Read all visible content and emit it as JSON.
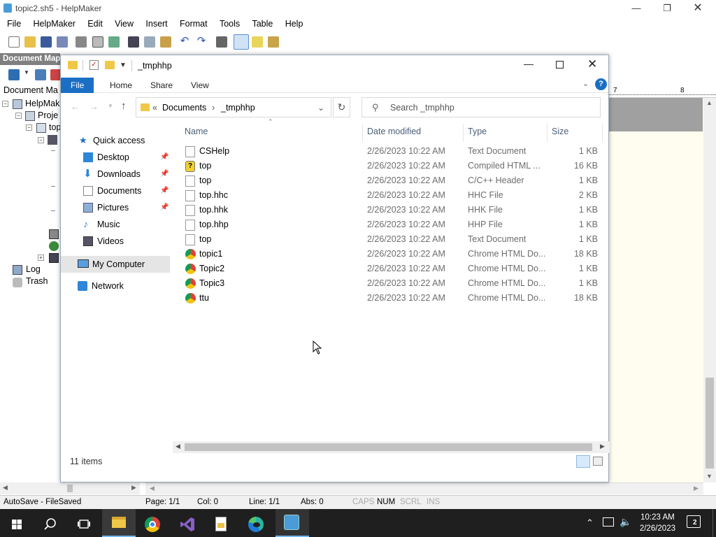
{
  "app": {
    "title": "topic2.sh5 - HelpMaker",
    "menu": [
      "File",
      "HelpMaker",
      "Edit",
      "View",
      "Insert",
      "Format",
      "Tools",
      "Table",
      "Help"
    ],
    "document_map": {
      "header": "Document Map",
      "label": "Document Ma",
      "tree": [
        {
          "label": "HelpMak"
        },
        {
          "label": "Proje"
        },
        {
          "label": "top"
        },
        {
          "label": "Log"
        },
        {
          "label": "Trash"
        }
      ]
    },
    "ruler": {
      "marks": [
        "7",
        "8"
      ]
    },
    "status": {
      "autosave": "AutoSave - FileSaved",
      "page": "Page: 1/1",
      "col": "Col: 0",
      "line": "Line: 1/1",
      "abs": "Abs: 0",
      "caps": "CAPS",
      "num": "NUM",
      "scrl": "SCRL",
      "ins": "INS"
    }
  },
  "explorer": {
    "title": "_tmphhp",
    "ribbon_tabs": [
      "File",
      "Home",
      "Share",
      "View"
    ],
    "address": {
      "prefix": "«",
      "parts": [
        "Documents",
        "_tmphhp"
      ]
    },
    "search_placeholder": "Search _tmphhp",
    "nav": [
      {
        "label": "Quick access",
        "icon": "star-icon"
      },
      {
        "label": "Desktop",
        "icon": "desktop-icon",
        "pinned": true
      },
      {
        "label": "Downloads",
        "icon": "download-icon",
        "pinned": true
      },
      {
        "label": "Documents",
        "icon": "documents-icon",
        "pinned": true
      },
      {
        "label": "Pictures",
        "icon": "pictures-icon",
        "pinned": true
      },
      {
        "label": "Music",
        "icon": "music-icon"
      },
      {
        "label": "Videos",
        "icon": "videos-icon"
      },
      {
        "label": "My Computer",
        "icon": "computer-icon",
        "selected": true
      },
      {
        "label": "Network",
        "icon": "network-icon"
      }
    ],
    "columns": [
      "Name",
      "Date modified",
      "Type",
      "Size"
    ],
    "files": [
      {
        "name": "CSHelp",
        "date": "2/26/2023 10:22 AM",
        "type": "Text Document",
        "size": "1 KB",
        "icon": "text-file-icon"
      },
      {
        "name": "top",
        "date": "2/26/2023 10:22 AM",
        "type": "Compiled HTML ...",
        "size": "16 KB",
        "icon": "chm-file-icon"
      },
      {
        "name": "top",
        "date": "2/26/2023 10:22 AM",
        "type": "C/C++ Header",
        "size": "1 KB",
        "icon": "generic-file-icon"
      },
      {
        "name": "top.hhc",
        "date": "2/26/2023 10:22 AM",
        "type": "HHC File",
        "size": "2 KB",
        "icon": "generic-file-icon"
      },
      {
        "name": "top.hhk",
        "date": "2/26/2023 10:22 AM",
        "type": "HHK File",
        "size": "1 KB",
        "icon": "generic-file-icon"
      },
      {
        "name": "top.hhp",
        "date": "2/26/2023 10:22 AM",
        "type": "HHP File",
        "size": "1 KB",
        "icon": "generic-file-icon"
      },
      {
        "name": "top",
        "date": "2/26/2023 10:22 AM",
        "type": "Text Document",
        "size": "1 KB",
        "icon": "text-file-icon"
      },
      {
        "name": "topic1",
        "date": "2/26/2023 10:22 AM",
        "type": "Chrome HTML Do...",
        "size": "18 KB",
        "icon": "chrome-html-icon"
      },
      {
        "name": "Topic2",
        "date": "2/26/2023 10:22 AM",
        "type": "Chrome HTML Do...",
        "size": "1 KB",
        "icon": "chrome-html-icon"
      },
      {
        "name": "Topic3",
        "date": "2/26/2023 10:22 AM",
        "type": "Chrome HTML Do...",
        "size": "1 KB",
        "icon": "chrome-html-icon"
      },
      {
        "name": "ttu",
        "date": "2/26/2023 10:22 AM",
        "type": "Chrome HTML Do...",
        "size": "18 KB",
        "icon": "chrome-html-icon"
      }
    ],
    "item_count": "11 items"
  },
  "taskbar": {
    "time": "10:23 AM",
    "date": "2/26/2023",
    "notifications": "2"
  },
  "colors": {
    "accent": "#1a6fc4",
    "taskbar": "#1f1f1f",
    "selected": "#e5e5e5"
  }
}
